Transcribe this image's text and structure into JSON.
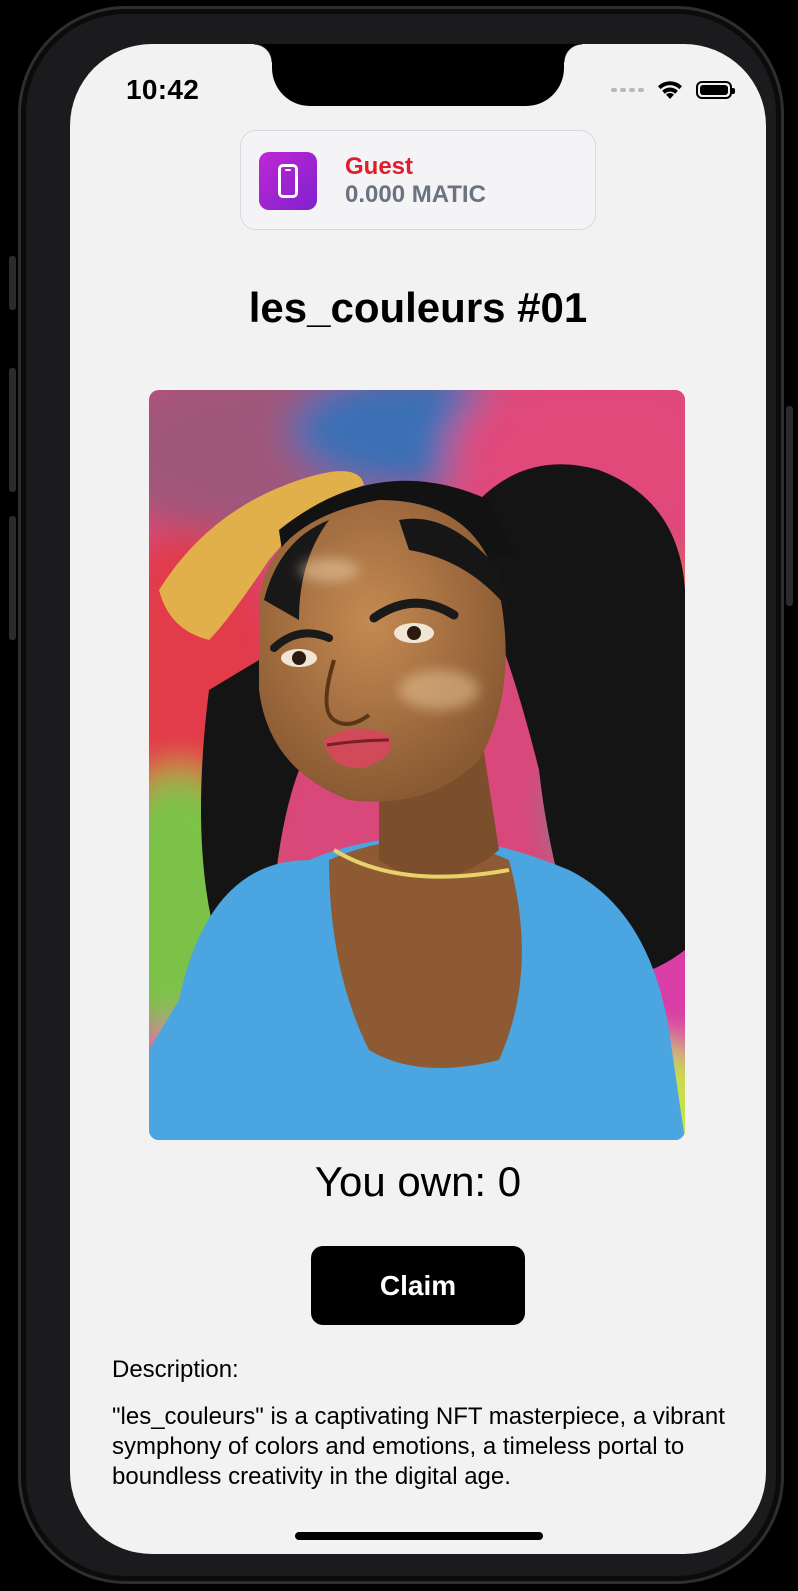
{
  "status_bar": {
    "time": "10:42"
  },
  "wallet": {
    "name": "Guest",
    "balance": "0.000 MATIC"
  },
  "nft": {
    "title": "les_couleurs #01",
    "image_alt": "Watercolor portrait of a woman with dark locs against colorful background",
    "owned_text": "You own: 0",
    "claim_label": "Claim",
    "description_label": "Description:",
    "description": "\"les_couleurs\" is a captivating NFT masterpiece, a vibrant symphony of colors and emotions, a timeless portal to boundless creativity in the digital age."
  },
  "colors": {
    "accent_text": "#e11d2a",
    "button_bg": "#000000",
    "wallet_icon_gradient_start": "#c026d3",
    "wallet_icon_gradient_end": "#7e22ce"
  }
}
